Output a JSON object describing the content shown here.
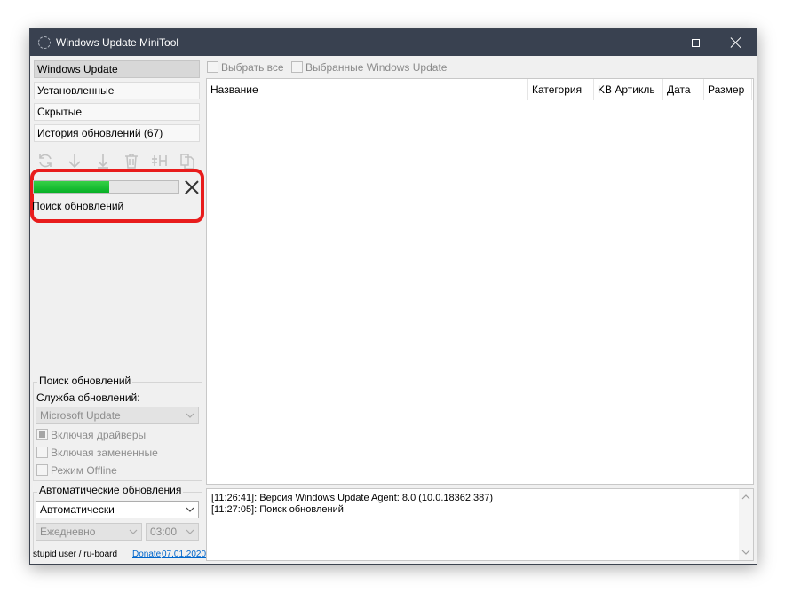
{
  "window": {
    "title": "Windows Update MiniTool"
  },
  "nav": {
    "items": [
      {
        "label": "Windows Update"
      },
      {
        "label": "Установленные"
      },
      {
        "label": "Скрытые"
      },
      {
        "label": "История обновлений (67)"
      }
    ]
  },
  "toolbar": {
    "icons": [
      "refresh-icon",
      "download-icon",
      "install-icon",
      "delete-icon",
      "hide-icon",
      "copy-icon"
    ]
  },
  "progress": {
    "value_percent": 52,
    "status": "Поиск обновлений"
  },
  "search_group": {
    "title": "Поиск обновлений",
    "service_label": "Служба обновлений:",
    "service_value": "Microsoft Update",
    "include_drivers": "Включая драйверы",
    "include_superseded": "Включая замененные",
    "offline_mode": "Режим Offline"
  },
  "auto_group": {
    "title": "Автоматические обновления",
    "mode_value": "Автоматически",
    "schedule_value": "Ежедневно",
    "time_value": "03:00"
  },
  "footer": {
    "credits": "stupid user / ru-board",
    "donate": "Donate",
    "date": "07.01.2020"
  },
  "list_toolbar": {
    "select_all": "Выбрать все",
    "selected": "Выбранные Windows Update"
  },
  "columns": [
    "Название",
    "Категория",
    "KB Артикль",
    "Дата",
    "Размер"
  ],
  "log": [
    "[11:26:41]: Версия Windows Update Agent: 8.0 (10.0.18362.387)",
    "[11:27:05]: Поиск обновлений"
  ],
  "colors": {
    "titlebar": "#394150",
    "progress": "#06b025",
    "highlight": "#e81c1c",
    "link": "#0066cc"
  }
}
